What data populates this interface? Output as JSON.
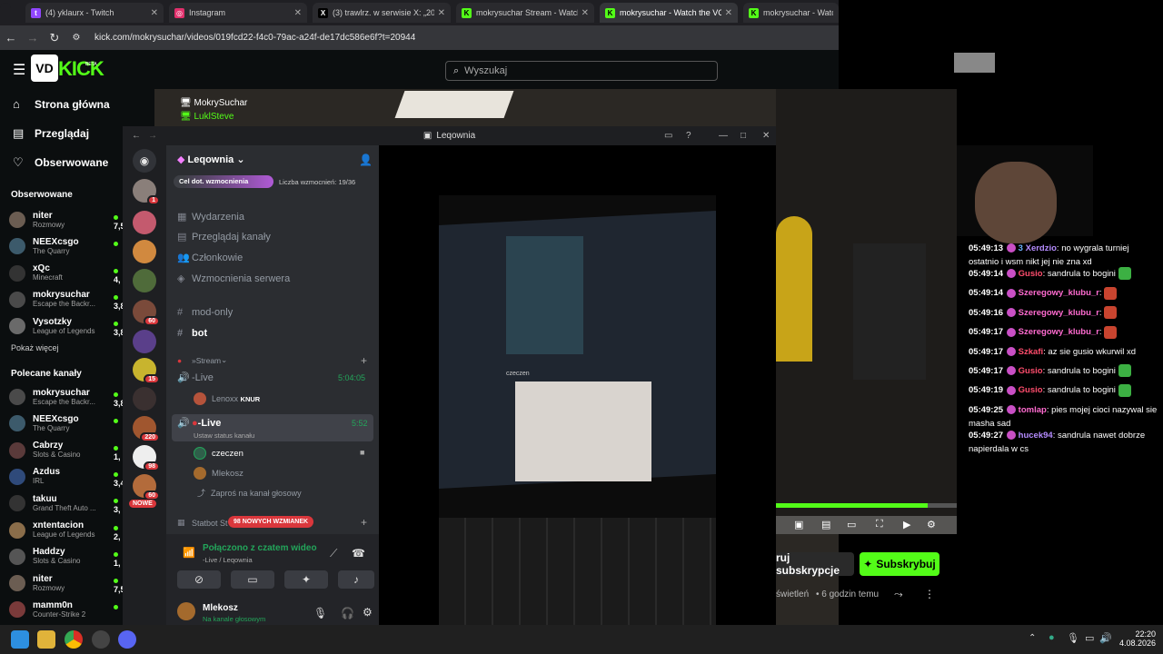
{
  "browser": {
    "tabs": [
      {
        "title": "(4) yklaurx - Twitch",
        "fav": "twitch"
      },
      {
        "title": "Instagram",
        "fav": "instagram"
      },
      {
        "title": "(3) trawlrz. w serwisie X: „2026/...",
        "fav": "x"
      },
      {
        "title": "mokrysuchar Stream - Watch L...",
        "fav": "kick"
      },
      {
        "title": "mokrysuchar - Watch the VOD",
        "fav": "kick"
      },
      {
        "title": "mokrysuchar - Watch the",
        "fav": "kick"
      }
    ],
    "url": "kick.com/mokrysuchar/videos/019fcd22-f4c0-79ac-a24f-de17dc586e6f?t=20944"
  },
  "kick": {
    "logo": "KICK",
    "beta": "BETA",
    "search_placeholder": "Wyszukaj",
    "nav": [
      {
        "label": "Strona główna",
        "icon": "home-icon"
      },
      {
        "label": "Przeglądaj",
        "icon": "browse-icon"
      },
      {
        "label": "Obserwowane",
        "icon": "heart-icon"
      }
    ],
    "followed_title": "Obserwowane",
    "followed": [
      {
        "name": "niter",
        "game": "Rozmowy",
        "viewers": "7,5"
      },
      {
        "name": "NEEXcsgo",
        "game": "The Quarry",
        "viewers": ""
      },
      {
        "name": "xQc",
        "game": "Minecraft",
        "viewers": "4,"
      },
      {
        "name": "mokrysuchar",
        "game": "Escape the Backr...",
        "viewers": "3,8"
      },
      {
        "name": "Vysotzky",
        "game": "League of Legends",
        "viewers": "3,8"
      }
    ],
    "show_more": "Pokaż więcej",
    "recommended_title": "Polecane kanały",
    "recommended": [
      {
        "name": "mokrysuchar",
        "game": "Escape the Backr...",
        "viewers": "3,8"
      },
      {
        "name": "NEEXcsgo",
        "game": "The Quarry",
        "viewers": ""
      },
      {
        "name": "Cabrzy",
        "game": "Slots & Casino",
        "viewers": "1,"
      },
      {
        "name": "Azdus",
        "game": "IRL",
        "viewers": "3,4"
      },
      {
        "name": "takuu",
        "game": "Grand Theft Auto ...",
        "viewers": "3,"
      },
      {
        "name": "xntentacion",
        "game": "League of Legends",
        "viewers": "2,"
      },
      {
        "name": "Haddzy",
        "game": "Slots & Casino",
        "viewers": "1,"
      },
      {
        "name": "niter",
        "game": "Rozmowy",
        "viewers": "7,5"
      },
      {
        "name": "mamm0n",
        "game": "Counter-Strike 2",
        "viewers": ""
      }
    ],
    "subscribe_label": "Subskrybuj",
    "gift_label": "ruj subskrypcje",
    "meta_views": "świetleń",
    "meta_time": "6 godzin temu"
  },
  "overlay_users": [
    "MokrySuchar",
    "LuklSteve"
  ],
  "discord": {
    "window_title": "Leqownia",
    "server_name": "Leqownia",
    "boost_goal": "Cel dot. wzmocnienia",
    "boost_count": "Liczba wzmocnień: 19/36",
    "menu": [
      "Wydarzenia",
      "Przeglądaj kanały",
      "Członkowie",
      "Wzmocnienia serwera"
    ],
    "text_channels": [
      "mod-only",
      "bot"
    ],
    "category": "Stream",
    "voice1": {
      "name": "-Live",
      "time": "5:04:05",
      "user": "Lenoxx",
      "user_tag": "KNUR"
    },
    "voice2": {
      "name": "-Live",
      "time": "5:52",
      "status": "Ustaw status kanału",
      "users": [
        "czeczen",
        "Mlekosz"
      ],
      "invite": "Zaproś na kanał głosowy"
    },
    "statbot": "Statbot St",
    "new_label": "NOWE",
    "mentions": "98 NOWYCH WZMIANEK",
    "connected": "Połączono z czatem wideo",
    "connected_sub": "-Live / Leqownia",
    "self_name": "Mlekosz",
    "self_status": "Na kanale głosowym",
    "server_badges": [
      "1",
      "60",
      "15",
      "220",
      "98",
      "60"
    ],
    "phone_user": "czeczen"
  },
  "chat": [
    {
      "time": "05:49:13",
      "badge": "3",
      "user": "Xerdzio",
      "color": "#b58cff",
      "text": "no wygrala turniej ostatnio i wsm nikt jej nie zna xd",
      "emote": ""
    },
    {
      "time": "05:49:14",
      "badge": "",
      "user": "Gusio",
      "color": "#ff4d6d",
      "text": "sandrula to bogini",
      "emote": "#3cb043"
    },
    {
      "time": "05:49:14",
      "badge": "",
      "user": "Szeregowy_klubu_r",
      "color": "#ff6bd0",
      "text": "",
      "emote": "#c8442f"
    },
    {
      "time": "05:49:16",
      "badge": "",
      "user": "Szeregowy_klubu_r",
      "color": "#ff6bd0",
      "text": "",
      "emote": "#c8442f"
    },
    {
      "time": "05:49:17",
      "badge": "",
      "user": "Szeregowy_klubu_r",
      "color": "#ff6bd0",
      "text": "",
      "emote": "#c8442f"
    },
    {
      "time": "05:49:17",
      "badge": "",
      "user": "Szkafi",
      "color": "#ff4d6d",
      "text": "az sie gusio wkurwil xd",
      "emote": ""
    },
    {
      "time": "05:49:17",
      "badge": "",
      "user": "Gusio",
      "color": "#ff4d6d",
      "text": "sandrula to bogini",
      "emote": "#3cb043"
    },
    {
      "time": "05:49:19",
      "badge": "",
      "user": "Gusio",
      "color": "#ff4d6d",
      "text": "sandrula to bogini",
      "emote": "#3cb043"
    },
    {
      "time": "05:49:25",
      "badge": "",
      "user": "tomlap",
      "color": "#ff6bd0",
      "text": "pies mojej cioci nazywal sie masha sad",
      "emote": ""
    },
    {
      "time": "05:49:27",
      "badge": "",
      "user": "hucek94",
      "color": "#b58cff",
      "text": "sandrula nawet dobrze napierdala w cs",
      "emote": ""
    }
  ],
  "taskbar": {
    "time": "22:20",
    "date": "4.08.2026"
  },
  "colors": {
    "kick_green": "#53fc18",
    "discord_red": "#da373c"
  }
}
